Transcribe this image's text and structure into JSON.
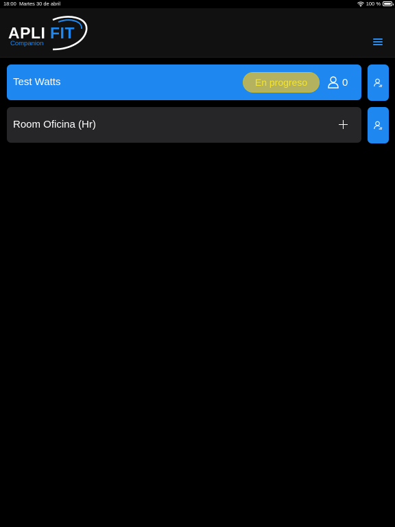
{
  "status_bar": {
    "time": "18:00",
    "date": "Martes 30 de abril",
    "battery": "100 %",
    "wifi_icon": "wifi-icon",
    "battery_icon": "battery-icon"
  },
  "header": {
    "logo": {
      "brand_part1": "APLI",
      "brand_part2": "FIT",
      "subtitle": "Companion"
    },
    "menu_icon": "hamburger-menu-icon"
  },
  "rooms": [
    {
      "name": "Test Watts",
      "status": "En progreso",
      "participants": "0",
      "state": "active",
      "icon": "person-icon",
      "side_icon": "person-edit-icon"
    },
    {
      "name": "Room Oficina (Hr)",
      "state": "idle",
      "icon": "plus-icon",
      "side_icon": "person-edit-icon"
    }
  ],
  "colors": {
    "accent": "#1e88f0",
    "background": "#000000",
    "header_bg": "#111112",
    "row_idle": "#262628",
    "status_pill_bg": "#b4b25e",
    "status_pill_text": "#f3e432"
  }
}
